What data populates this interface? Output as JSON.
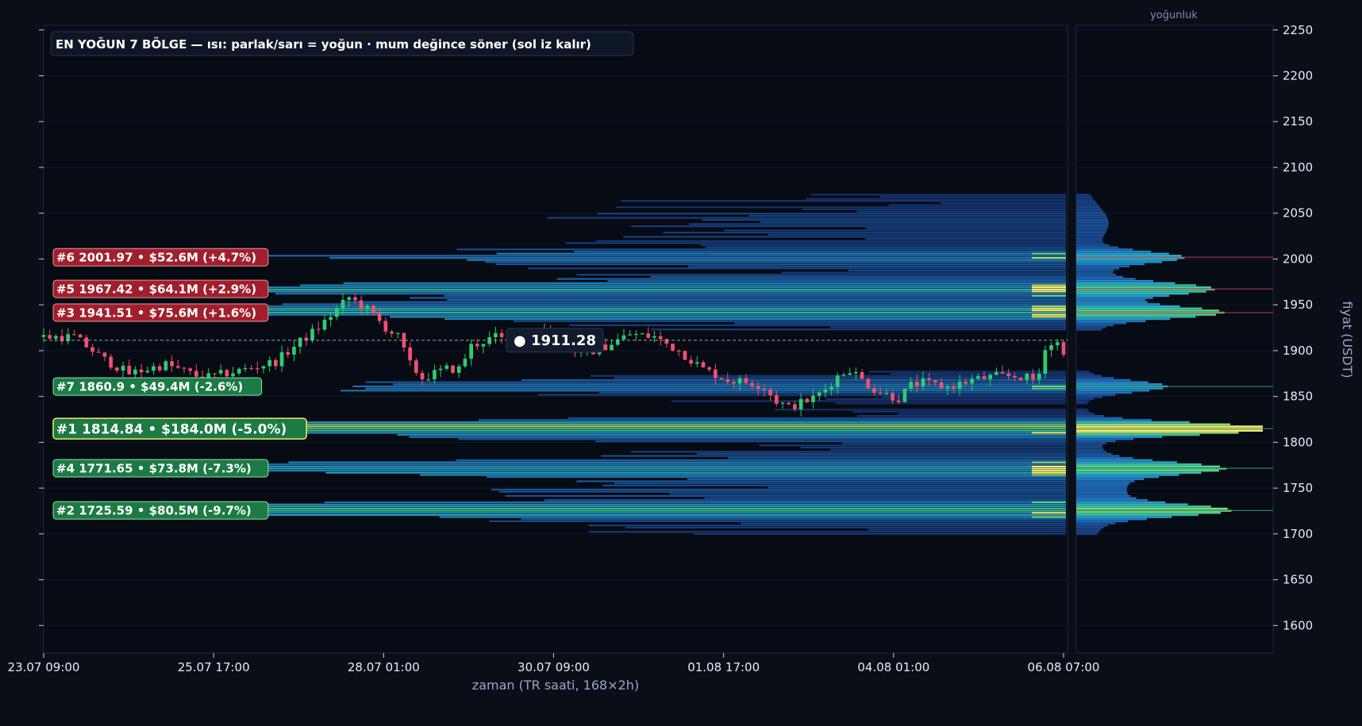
{
  "title": "EN YOĞUN 7 BÖLGE — ısı: parlak/sarı = yoğun · mum değince söner (sol iz kalır)",
  "profile_title": "yoğunluk",
  "xlabel": "zaman (TR saati, 168×2h)",
  "ylabel": "fiyat (USDT)",
  "current_price_label": "● 1911.28",
  "colors": {
    "background": "#0a0e16",
    "panel": "#060b14",
    "up_candle": "#2ecc71",
    "down_candle": "#f0506e",
    "resistance_label": "#a11f2c",
    "support_label": "#1c7a45",
    "heat_low": "#1e3a70",
    "heat_mid": "#2aa6cc",
    "heat_high": "#f5ea64"
  },
  "chart_data": {
    "type": "candlestick-heatmap",
    "y_range": [
      1570,
      2255
    ],
    "y_ticks": [
      "1600",
      "1650",
      "1700",
      "1750",
      "1800",
      "1850",
      "1900",
      "1950",
      "2000",
      "2050",
      "2100",
      "2150",
      "2200",
      "2250"
    ],
    "x_ticks": [
      "23.07 09:00",
      "25.07 17:00",
      "28.07 01:00",
      "30.07 09:00",
      "01.08 17:00",
      "04.08 01:00",
      "06.08 07:00"
    ],
    "current_price": 1911.28,
    "zones": [
      {
        "rank": 1,
        "label": "#1  1814.84  •  $184.0M  (-5.0%)",
        "price": 1814.84,
        "side": "support",
        "strength": 1.0
      },
      {
        "rank": 2,
        "label": "#2  1725.59  •  $80.5M  (-9.7%)",
        "price": 1725.59,
        "side": "support",
        "strength": 0.62
      },
      {
        "rank": 3,
        "label": "#3  1941.51  •  $75.6M  (+1.6%)",
        "price": 1941.51,
        "side": "resistance",
        "strength": 0.6
      },
      {
        "rank": 4,
        "label": "#4  1771.65  •  $73.8M  (-7.3%)",
        "price": 1771.65,
        "side": "support",
        "strength": 0.58
      },
      {
        "rank": 5,
        "label": "#5  1967.42  •  $64.1M  (+2.9%)",
        "price": 1967.42,
        "side": "resistance",
        "strength": 0.52
      },
      {
        "rank": 6,
        "label": "#6  2001.97  •  $52.6M  (+4.7%)",
        "price": 2001.97,
        "side": "resistance",
        "strength": 0.46
      },
      {
        "rank": 7,
        "label": "#7  1860.9  •  $49.4M  (-2.6%)",
        "price": 1860.9,
        "side": "support",
        "strength": 0.44
      }
    ],
    "candle_path_anchors": [
      [
        0,
        1915
      ],
      [
        5,
        1915
      ],
      [
        10,
        1890
      ],
      [
        14,
        1875
      ],
      [
        20,
        1885
      ],
      [
        26,
        1870
      ],
      [
        32,
        1878
      ],
      [
        38,
        1888
      ],
      [
        42,
        1910
      ],
      [
        45,
        1925
      ],
      [
        48,
        1945
      ],
      [
        50,
        1958
      ],
      [
        53,
        1945
      ],
      [
        56,
        1925
      ],
      [
        58,
        1915
      ],
      [
        60,
        1885
      ],
      [
        62,
        1870
      ],
      [
        66,
        1880
      ],
      [
        68,
        1880
      ],
      [
        70,
        1905
      ],
      [
        74,
        1915
      ],
      [
        78,
        1905
      ],
      [
        82,
        1925
      ],
      [
        86,
        1905
      ],
      [
        88,
        1895
      ],
      [
        92,
        1905
      ],
      [
        96,
        1918
      ],
      [
        100,
        1915
      ],
      [
        104,
        1900
      ],
      [
        106,
        1890
      ],
      [
        108,
        1880
      ],
      [
        112,
        1868
      ],
      [
        116,
        1865
      ],
      [
        118,
        1860
      ],
      [
        120,
        1845
      ],
      [
        122,
        1838
      ],
      [
        126,
        1848
      ],
      [
        128,
        1858
      ],
      [
        130,
        1872
      ],
      [
        132,
        1880
      ],
      [
        134,
        1868
      ],
      [
        136,
        1858
      ],
      [
        138,
        1852
      ],
      [
        140,
        1848
      ],
      [
        142,
        1862
      ],
      [
        144,
        1865
      ],
      [
        148,
        1860
      ],
      [
        152,
        1868
      ],
      [
        156,
        1872
      ],
      [
        160,
        1872
      ],
      [
        162,
        1868
      ],
      [
        163,
        1875
      ],
      [
        164,
        1905
      ],
      [
        166,
        1908
      ],
      [
        167,
        1900
      ]
    ]
  }
}
